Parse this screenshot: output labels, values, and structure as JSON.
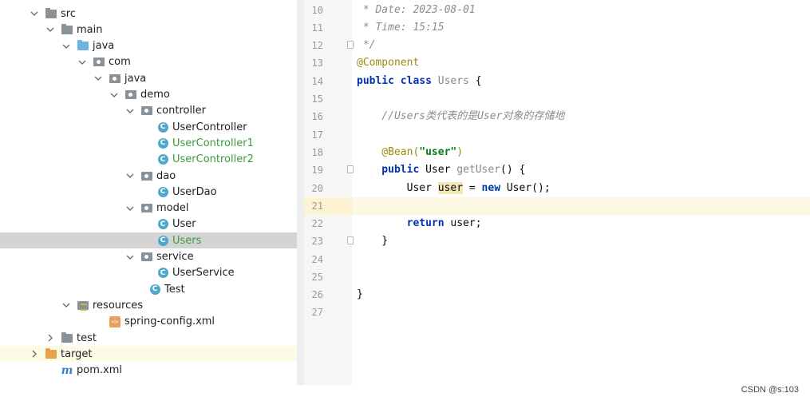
{
  "tree": [
    {
      "label": "src",
      "icon": "folder-icon",
      "kind": "folder",
      "chev": "down",
      "depth": 0
    },
    {
      "label": "main",
      "icon": "folder-icon",
      "kind": "folder",
      "chev": "down",
      "depth": 1
    },
    {
      "label": "java",
      "icon": "source-folder-icon",
      "kind": "folder-blue",
      "chev": "down",
      "depth": 2
    },
    {
      "label": "com",
      "icon": "package-icon",
      "kind": "pkg",
      "chev": "down",
      "depth": 3
    },
    {
      "label": "java",
      "icon": "package-icon",
      "kind": "pkg",
      "chev": "down",
      "depth": 4
    },
    {
      "label": "demo",
      "icon": "package-icon",
      "kind": "pkg",
      "chev": "down",
      "depth": 5
    },
    {
      "label": "controller",
      "icon": "package-icon",
      "kind": "pkg",
      "chev": "down",
      "depth": 6
    },
    {
      "label": "UserController",
      "icon": "class-icon",
      "kind": "cls",
      "chev": "",
      "depth": 7
    },
    {
      "label": "UserController1",
      "icon": "class-icon",
      "kind": "cls",
      "chev": "",
      "depth": 7,
      "green": true
    },
    {
      "label": "UserController2",
      "icon": "class-icon",
      "kind": "cls",
      "chev": "",
      "depth": 7,
      "green": true
    },
    {
      "label": "dao",
      "icon": "package-icon",
      "kind": "pkg",
      "chev": "down",
      "depth": 6
    },
    {
      "label": "UserDao",
      "icon": "class-icon",
      "kind": "cls",
      "chev": "",
      "depth": 7
    },
    {
      "label": "model",
      "icon": "package-icon",
      "kind": "pkg",
      "chev": "down",
      "depth": 6
    },
    {
      "label": "User",
      "icon": "class-icon",
      "kind": "cls",
      "chev": "",
      "depth": 7
    },
    {
      "label": "Users",
      "icon": "class-icon",
      "kind": "cls",
      "chev": "",
      "depth": 7,
      "green": true,
      "selected": true
    },
    {
      "label": "service",
      "icon": "package-icon",
      "kind": "pkg",
      "chev": "down",
      "depth": 6
    },
    {
      "label": "UserService",
      "icon": "class-icon",
      "kind": "cls",
      "chev": "",
      "depth": 7
    },
    {
      "label": "Test",
      "icon": "runnable-class-icon",
      "kind": "cls",
      "chev": "",
      "depth": 6.5
    },
    {
      "label": "resources",
      "icon": "resources-folder-icon",
      "kind": "res",
      "chev": "down",
      "depth": 2
    },
    {
      "label": "spring-config.xml",
      "icon": "xml-file-icon",
      "kind": "xml",
      "chev": "",
      "depth": 4
    },
    {
      "label": "test",
      "icon": "folder-icon",
      "kind": "folder",
      "chev": "right",
      "depth": 1
    },
    {
      "label": "target",
      "icon": "excluded-folder-icon",
      "kind": "folder-orange",
      "chev": "right",
      "depth": 0,
      "yellow": true
    },
    {
      "label": "pom.xml",
      "icon": "maven-file-icon",
      "kind": "pom",
      "chev": "",
      "depth": 1
    }
  ],
  "class_icon_letter": "C",
  "xml_icon_text": "<>",
  "pom_icon_text": "m",
  "line_numbers": [
    "10",
    "11",
    "12",
    "13",
    "14",
    "15",
    "16",
    "17",
    "18",
    "19",
    "20",
    "21",
    "22",
    "23",
    "24",
    "25",
    "26",
    "27"
  ],
  "code": {
    "l10": " * Date: 2023-08-01",
    "l11": " * Time: 15:15",
    "l12": " */",
    "l13": "@Component",
    "l14_kw": "public class",
    "l14_name": "Users",
    "l14_rest": " {",
    "l16": "    //Users类代表的是User对象的存储地",
    "l18_ann": "    @Bean(",
    "l18_str": "\"user\"",
    "l18_end": ")",
    "l19_kw": "    public",
    "l19_type": " User ",
    "l19_name": "getUser",
    "l19_end": "() {",
    "l20_a": "        User ",
    "l20_var": "user",
    "l20_b": " = ",
    "l20_kw": "new",
    "l20_c": " User();",
    "l22_kw": "        return",
    "l22_rest": " user;",
    "l23": "    }",
    "l26": "}"
  },
  "watermark": "CSDN @s:103"
}
